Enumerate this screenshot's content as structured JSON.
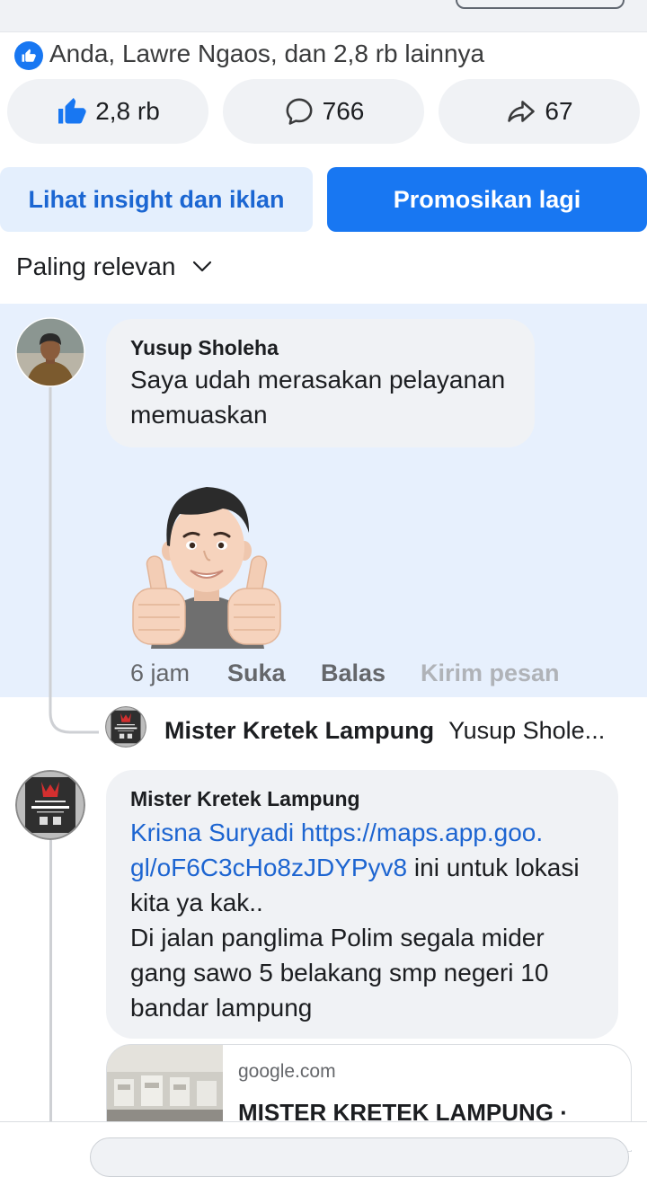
{
  "colors": {
    "accent": "#1877f2",
    "highlight_bg": "#e7f0fd",
    "bubble_bg": "#f0f2f5",
    "link": "#1d65d1",
    "secondary_text": "#65676b"
  },
  "icons": {
    "like": "like-icon",
    "comment": "comment-icon",
    "share": "share-icon",
    "sort": "chevron-down-icon",
    "sticker": "thumbs-up-sticker"
  },
  "reactions": {
    "summary": "Anda, Lawre Ngaos, dan 2,8 rb lainnya"
  },
  "stats": {
    "likes": "2,8 rb",
    "comments": "766",
    "shares": "67"
  },
  "post_actions": {
    "insight_label": "Lihat insight dan iklan",
    "promote_label": "Promosikan lagi"
  },
  "sort": {
    "label": "Paling relevan"
  },
  "comments": [
    {
      "author": "Yusup Sholeha",
      "text_lines": [
        "Saya udah merasakan pelayanan",
        "memuaskan"
      ],
      "time": "6 jam",
      "like_label": "Suka",
      "reply_label": "Balas",
      "message_label": "Kirim pesan",
      "reply_preview": {
        "author": "Mister Kretek Lampung",
        "snippet": "Yusup Shole..."
      }
    },
    {
      "author": "Mister Kretek Lampung",
      "mention": "Krisna Suryadi",
      "link_line1": "https://maps.app.goo.",
      "link_line2": "gl/oF6C3cHo8zJDYPyv8",
      "line2_text": "ini untuk lokasi",
      "text_lines": [
        "kita ya kak..",
        "Di jalan panglima Polim segala mider",
        "gang sawo 5 belakang smp negeri 10",
        "bandar lampung"
      ],
      "link_preview": {
        "domain": "google.com",
        "title": "MISTER KRETEK LAMPUNG ·"
      }
    }
  ]
}
